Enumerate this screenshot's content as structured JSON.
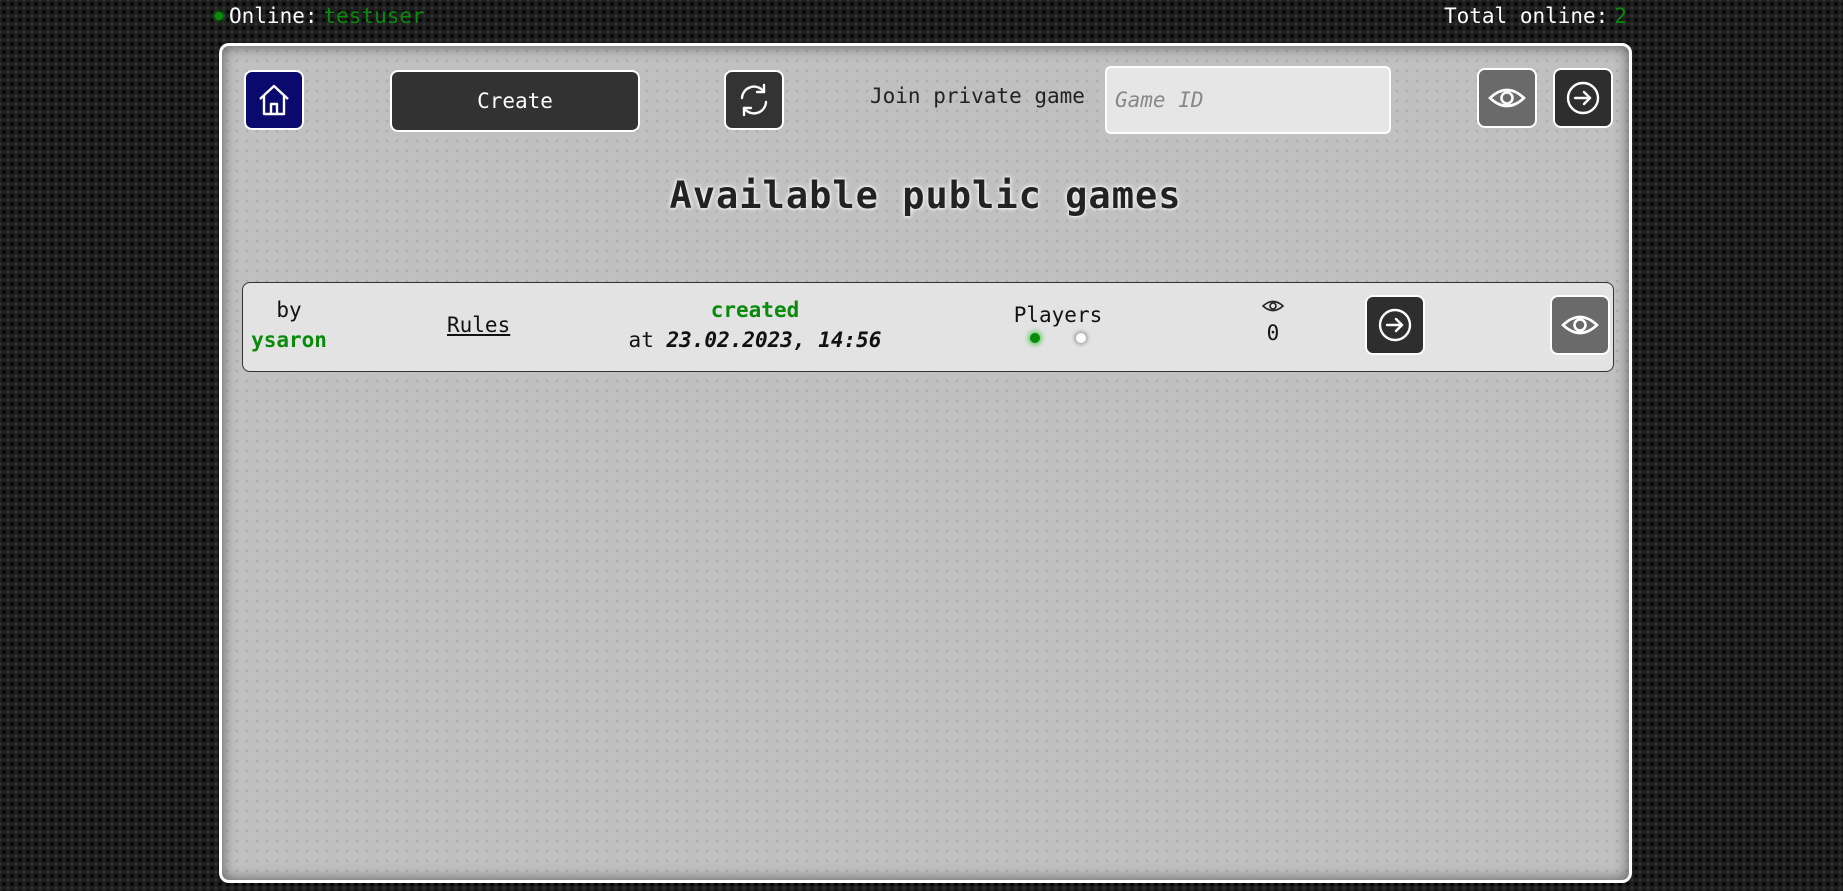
{
  "header": {
    "online_label": "Online:",
    "username": "testuser",
    "total_label": "Total online:",
    "total_count": "2"
  },
  "toolbar": {
    "home_icon": "home-icon",
    "create_label": "Create",
    "refresh_icon": "refresh-icon",
    "join_label": "Join private game",
    "game_id_placeholder": "Game ID",
    "game_id_value": "",
    "watch_icon": "eye-icon",
    "enter_icon": "arrow-right-circle-icon"
  },
  "main": {
    "title": "Available public games",
    "games": [
      {
        "by_label": "by",
        "author": "ysaron",
        "rules_label": "Rules",
        "created_label": "created",
        "at_label": "at",
        "created_at": "23.02.2023, 14:56",
        "players_label": "Players",
        "players_filled": 1,
        "players_total": 2,
        "spectators": "0"
      }
    ]
  },
  "colors": {
    "accent_green": "#0a8a0a",
    "home_blue": "#0a0a6e",
    "button_dark": "#323232",
    "panel_gray": "#c0c0c0"
  }
}
